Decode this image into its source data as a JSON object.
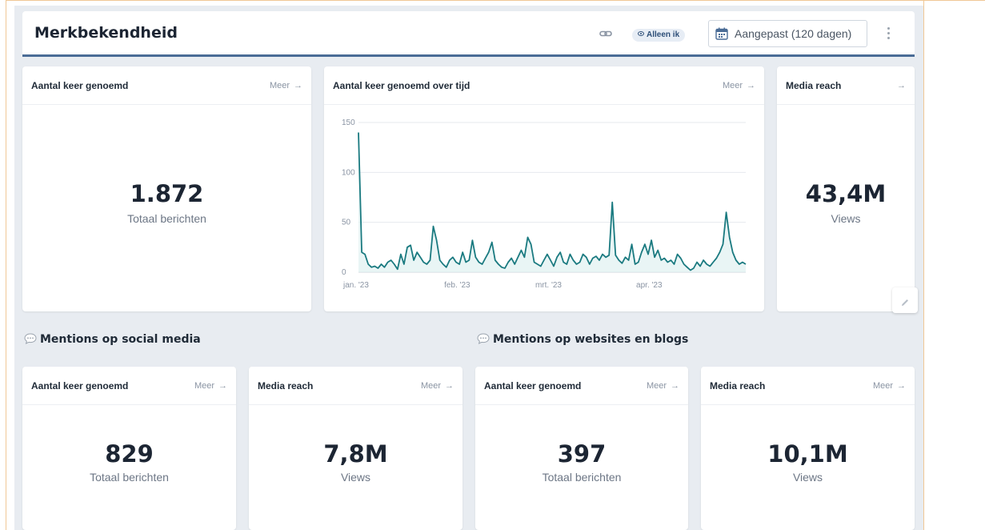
{
  "header": {
    "title": "Merkbekendheid",
    "visibility_label": "Alleen ik",
    "date_range_label": "Aangepast (120 dagen)"
  },
  "top_cards": {
    "mentions": {
      "title": "Aantal keer genoemd",
      "more": "Meer",
      "value": "1.872",
      "unit": "Totaal berichten"
    },
    "over_time": {
      "title": "Aantal keer genoemd over tijd",
      "more": "Meer"
    },
    "reach": {
      "title": "Media reach",
      "value": "43,4M",
      "unit": "Views"
    }
  },
  "sections": {
    "social": {
      "title": "Mentions op social media",
      "mentions": {
        "title": "Aantal keer genoemd",
        "more": "Meer",
        "value": "829",
        "unit": "Totaal berichten"
      },
      "reach": {
        "title": "Media reach",
        "more": "Meer",
        "value": "7,8M",
        "unit": "Views"
      }
    },
    "web": {
      "title": "Mentions op websites en blogs",
      "mentions": {
        "title": "Aantal keer genoemd",
        "more": "Meer",
        "value": "397",
        "unit": "Totaal berichten"
      },
      "reach": {
        "title": "Media reach",
        "more": "Meer",
        "value": "10,1M",
        "unit": "Views"
      }
    }
  },
  "icons": {
    "link": "link-icon",
    "visibility": "eye-icon",
    "calendar": "calendar-icon",
    "more": "kebab-menu-icon",
    "arrow": "arrow-right-icon",
    "chat": "chat-bubble-icon",
    "edit": "pencil-icon"
  },
  "colors": {
    "accent": "#4a6c96",
    "line": "#1a7a80",
    "area": "#dff1f1"
  },
  "chart_data": {
    "type": "area",
    "title": "Aantal keer genoemd over tijd",
    "ylim": [
      0,
      150
    ],
    "yticks": [
      0,
      50,
      100,
      150
    ],
    "xtick_labels": [
      "jan. '23",
      "feb. '23",
      "mrt. '23",
      "apr. '23"
    ],
    "xtick_days": [
      0,
      31,
      59,
      90
    ],
    "grid": true,
    "series": [
      {
        "values": [
          140,
          20,
          18,
          8,
          5,
          6,
          4,
          8,
          5,
          10,
          12,
          8,
          3,
          18,
          8,
          25,
          27,
          12,
          20,
          15,
          10,
          8,
          12,
          46,
          32,
          12,
          8,
          5,
          12,
          15,
          10,
          8,
          20,
          10,
          12,
          32,
          15,
          10,
          8,
          14,
          20,
          30,
          12,
          8,
          5,
          4,
          10,
          14,
          8,
          15,
          22,
          15,
          35,
          28,
          10,
          8,
          6,
          12,
          18,
          12,
          6,
          15,
          20,
          10,
          8,
          18,
          12,
          8,
          10,
          18,
          15,
          8,
          14,
          16,
          12,
          18,
          15,
          17,
          70,
          17,
          12,
          9,
          15,
          12,
          28,
          8,
          10,
          20,
          28,
          18,
          32,
          15,
          22,
          12,
          14,
          10,
          12,
          8,
          18,
          14,
          8,
          5,
          2,
          4,
          10,
          6,
          12,
          8,
          6,
          10,
          14,
          20,
          28,
          60,
          35,
          20,
          12,
          8,
          10,
          8
        ]
      }
    ]
  }
}
